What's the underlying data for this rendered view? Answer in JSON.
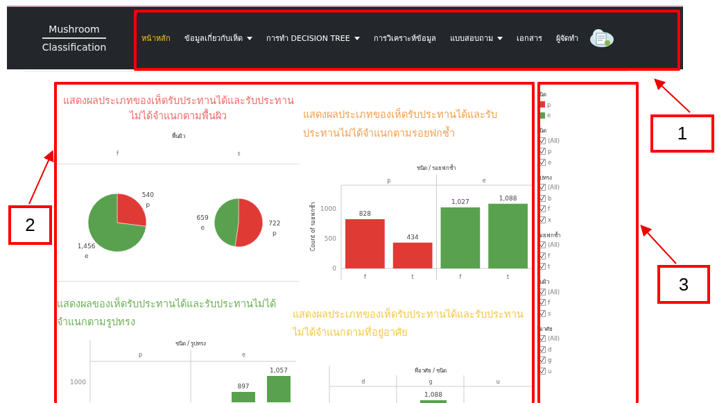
{
  "navbar": {
    "brand_top": "Mushroom",
    "brand_bottom": "Classification",
    "items": [
      {
        "label": "หน้าหลัก",
        "selected": true,
        "dropdown": false
      },
      {
        "label": "ข้อมูลเกี่ยวกับเห็ด",
        "selected": false,
        "dropdown": true
      },
      {
        "label": "การทำ DECISION TREE",
        "selected": false,
        "dropdown": true
      },
      {
        "label": "การวิเคราะห์ข้อมูล",
        "selected": false,
        "dropdown": false
      },
      {
        "label": "แบบสอบถาม",
        "selected": false,
        "dropdown": true
      },
      {
        "label": "เอกสาร",
        "selected": false,
        "dropdown": false
      },
      {
        "label": "ผู้จัดทำ",
        "selected": false,
        "dropdown": false
      }
    ]
  },
  "charts": [
    {
      "kind": "pie",
      "title": "แสดงผลประเภทของเห็ดรับประทานได้และรับประทานไม่ได้จำแนกตามพื้นผิว",
      "color": "#f26b6b",
      "header": "พื้นผิว",
      "facets": [
        {
          "label": "f",
          "chart_data": {
            "type": "pie",
            "categories": [
              "p",
              "e"
            ],
            "values": [
              540,
              1456
            ],
            "value_labels": [
              "540",
              "1,456"
            ]
          }
        },
        {
          "label": "s",
          "chart_data": {
            "type": "pie",
            "categories": [
              "p",
              "e"
            ],
            "values": [
              722,
              659
            ],
            "value_labels": [
              "722",
              "659"
            ]
          }
        }
      ]
    },
    {
      "kind": "bar",
      "title": "แสดงผลประเภทของเห็ดรับประทานได้และรับประทานไม่ได้จำแนกตามรอยฟกช้ำ",
      "color": "#f5a04c",
      "header": "ชนิด / รอยฟกช้ำ",
      "facets": [
        "p",
        "e"
      ],
      "chart_data": {
        "type": "bar",
        "ylabel": "Count of รอยฟกช้ำ",
        "categories": [
          "f",
          "t",
          "f",
          "t"
        ],
        "series": [
          {
            "color": "#e03a35",
            "values": [
              828,
              434,
              null,
              null
            ]
          },
          {
            "color": "#59a14f",
            "values": [
              null,
              null,
              1027,
              1088
            ]
          }
        ],
        "ylim": [
          0,
          1400
        ],
        "yticks": [
          0,
          500,
          1000
        ],
        "value_labels": [
          "828",
          "434",
          "1,027",
          "1,088"
        ]
      }
    },
    {
      "kind": "bar_cut",
      "title": "แสดงผลของเห็ดรับประทานได้และรับประทานไม่ได้จำแนกตามรูปทรง",
      "color": "#6cb357",
      "header": "ชนิด / รูปทรง",
      "facets": [
        "p",
        "e"
      ],
      "tick": "1000",
      "bar_labels": [
        "897",
        "1,057"
      ]
    },
    {
      "kind": "bar_cut",
      "title": "แสดงผลประเภทของเห็ดรับประทานได้และรับประทานไม่ได้จำแนกตามที่อยู่อาศัย",
      "color": "#f2c94c",
      "header": "ที่อาศัย / ชนิด",
      "facets": [
        "d",
        "g",
        "u"
      ],
      "bar_labels": [
        "1,088"
      ]
    }
  ],
  "sidebar": {
    "legend": {
      "title": "นิด",
      "items": [
        {
          "label": "p",
          "color": "#e03a35"
        },
        {
          "label": "e",
          "color": "#59a14f"
        }
      ]
    },
    "filters": [
      {
        "title": "นิด",
        "options": [
          {
            "label": "(All)",
            "checked": true
          },
          {
            "label": "p",
            "checked": true
          },
          {
            "label": "e",
            "checked": true
          }
        ]
      },
      {
        "title": "ปทรง",
        "options": [
          {
            "label": "(All)",
            "checked": true
          },
          {
            "label": "b",
            "checked": true
          },
          {
            "label": "f",
            "checked": true
          },
          {
            "label": "x",
            "checked": true
          }
        ]
      },
      {
        "title": "อยฟกช้ำ",
        "options": [
          {
            "label": "(All)",
            "checked": true
          },
          {
            "label": "f",
            "checked": true
          },
          {
            "label": "t",
            "checked": true
          }
        ]
      },
      {
        "title": "นผิว",
        "options": [
          {
            "label": "(All)",
            "checked": true
          },
          {
            "label": "f",
            "checked": true
          },
          {
            "label": "s",
            "checked": true
          }
        ]
      },
      {
        "title": "อาศัย",
        "options": [
          {
            "label": "(All)",
            "checked": true
          },
          {
            "label": "d",
            "checked": true
          },
          {
            "label": "g",
            "checked": true
          },
          {
            "label": "u",
            "checked": true
          }
        ]
      }
    ]
  },
  "annotations": [
    {
      "label": "1"
    },
    {
      "label": "2"
    },
    {
      "label": "3"
    }
  ]
}
